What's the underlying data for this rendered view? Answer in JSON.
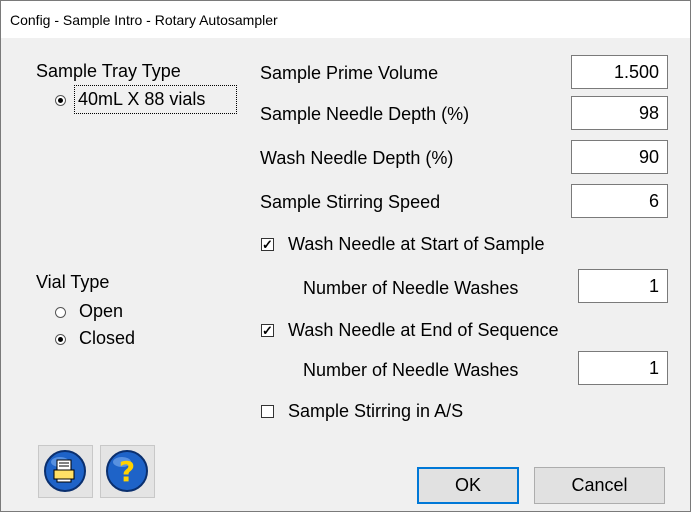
{
  "window": {
    "title": "Config - Sample Intro - Rotary Autosampler"
  },
  "tray": {
    "heading": "Sample Tray Type",
    "options": [
      {
        "label": "40mL X 88 vials",
        "selected": true
      }
    ]
  },
  "vial": {
    "heading": "Vial Type",
    "options": [
      {
        "label": "Open",
        "selected": false
      },
      {
        "label": "Closed",
        "selected": true
      }
    ]
  },
  "fields": {
    "prime_volume": {
      "label": "Sample Prime Volume",
      "value": "1.500"
    },
    "sample_depth": {
      "label": "Sample Needle Depth (%)",
      "value": "98"
    },
    "wash_depth": {
      "label": "Wash Needle Depth (%)",
      "value": "90"
    },
    "stirring_speed": {
      "label": "Sample Stirring Speed",
      "value": "6"
    }
  },
  "wash_start": {
    "label": "Wash Needle at Start of Sample",
    "checked": true,
    "washes_label": "Number of Needle Washes",
    "washes_value": "1"
  },
  "wash_end": {
    "label": "Wash Needle at End of Sequence",
    "checked": true,
    "washes_label": "Number of Needle Washes",
    "washes_value": "1"
  },
  "stir_in_as": {
    "label": "Sample Stirring in A/S",
    "checked": false
  },
  "buttons": {
    "ok": "OK",
    "cancel": "Cancel"
  },
  "icons": {
    "print": "print-icon",
    "help": "help-icon",
    "help_glyph": "?"
  },
  "colors": {
    "icon_blue": "#1e63c8",
    "help_yellow": "#ffd200",
    "focus_blue": "#0078d7"
  }
}
